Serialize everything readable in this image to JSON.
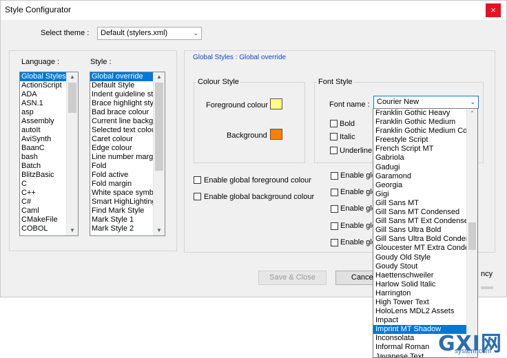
{
  "window": {
    "title": "Style Configurator",
    "close_glyph": "×"
  },
  "theme": {
    "label": "Select theme :",
    "value": "Default (stylers.xml)"
  },
  "language": {
    "label": "Language :",
    "selected": 0,
    "items": [
      "Global Styles",
      "ActionScript",
      "ADA",
      "ASN.1",
      "asp",
      "Assembly",
      "autoIt",
      "AviSynth",
      "BaanC",
      "bash",
      "Batch",
      "BlitzBasic",
      "C",
      "C++",
      "C#",
      "Caml",
      "CMakeFile",
      "COBOL"
    ]
  },
  "style": {
    "label": "Style :",
    "selected": 0,
    "items": [
      "Global override",
      "Default Style",
      "Indent guideline style",
      "Brace highlight style",
      "Bad brace colour",
      "Current line background",
      "Selected text colour",
      "Caret colour",
      "Edge colour",
      "Line number margin",
      "Fold",
      "Fold active",
      "Fold margin",
      "White space symbol",
      "Smart HighLighting",
      "Find Mark Style",
      "Mark Style 1",
      "Mark Style 2"
    ]
  },
  "panel": {
    "header": "Global Styles : Global override"
  },
  "colour_style": {
    "title": "Colour Style",
    "foreground_label": "Foreground colour",
    "background_label": "Background",
    "foreground_color": "#ffff80",
    "background_color": "#ff8000"
  },
  "font_style": {
    "title": "Font Style",
    "font_name_label": "Font name :",
    "font_name_value": "Courier New",
    "bold": "Bold",
    "italic": "Italic",
    "underline": "Underline"
  },
  "global_checks": {
    "fg": "Enable global foreground colour",
    "bg": "Enable global background colour",
    "right": [
      "Enable glo",
      "Enable glo",
      "Enable glo",
      "Enable glo",
      "Enable glo"
    ]
  },
  "buttons": {
    "save_close": "Save & Close",
    "cancel": "Cancel",
    "transparency_fragment": "ncy"
  },
  "font_dropdown": {
    "selected_index": 24,
    "items": [
      "Franklin Gothic Heavy",
      "Franklin Gothic Medium",
      "Franklin Gothic Medium Con",
      "Freestyle Script",
      "French Script MT",
      "Gabriola",
      "Gadugi",
      "Garamond",
      "Georgia",
      "Gigi",
      "Gill Sans MT",
      "Gill Sans MT Condensed",
      "Gill Sans MT Ext Condensed",
      "Gill Sans Ultra Bold",
      "Gill Sans Ultra Bold Condens",
      "Gloucester MT Extra Conde",
      "Goudy Old Style",
      "Goudy Stout",
      "Haettenschweiler",
      "Harlow Solid Italic",
      "Harrington",
      "High Tower Text",
      "HoloLens MDL2 Assets",
      "Impact",
      "Imprint MT Shadow",
      "Inconsolata",
      "Informal Roman",
      "Javanese Text"
    ]
  },
  "watermark": {
    "brand": "GXI网",
    "site": "system.com"
  },
  "colors": {
    "accent": "#0078d7",
    "panel_header": "#0a46c8",
    "close": "#e81123"
  }
}
